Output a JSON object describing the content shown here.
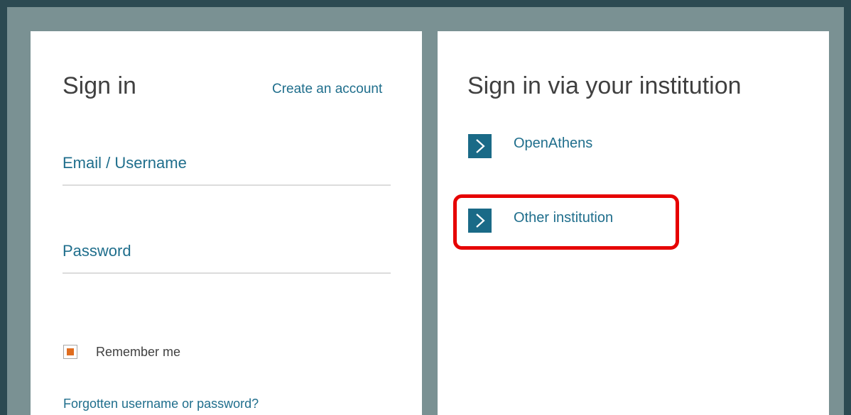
{
  "sign_in": {
    "title": "Sign in",
    "create_account": "Create an account",
    "email_label": "Email / Username",
    "email_value": "",
    "password_label": "Password",
    "password_value": "",
    "remember_label": "Remember me",
    "remember_checked": true,
    "forgot_link": "Forgotten username or password?"
  },
  "institution": {
    "title": "Sign in via your institution",
    "options": [
      {
        "label": "OpenAthens",
        "icon": "chevron-right-icon"
      },
      {
        "label": "Other institution",
        "icon": "chevron-right-icon",
        "highlighted": true
      }
    ]
  },
  "colors": {
    "outer_frame": "#2c4a52",
    "inner_frame": "#7a9193",
    "link": "#1f6e8c",
    "arrow_box": "#1a6a87",
    "checkbox_fill": "#e06d1f",
    "highlight": "#e60000"
  }
}
